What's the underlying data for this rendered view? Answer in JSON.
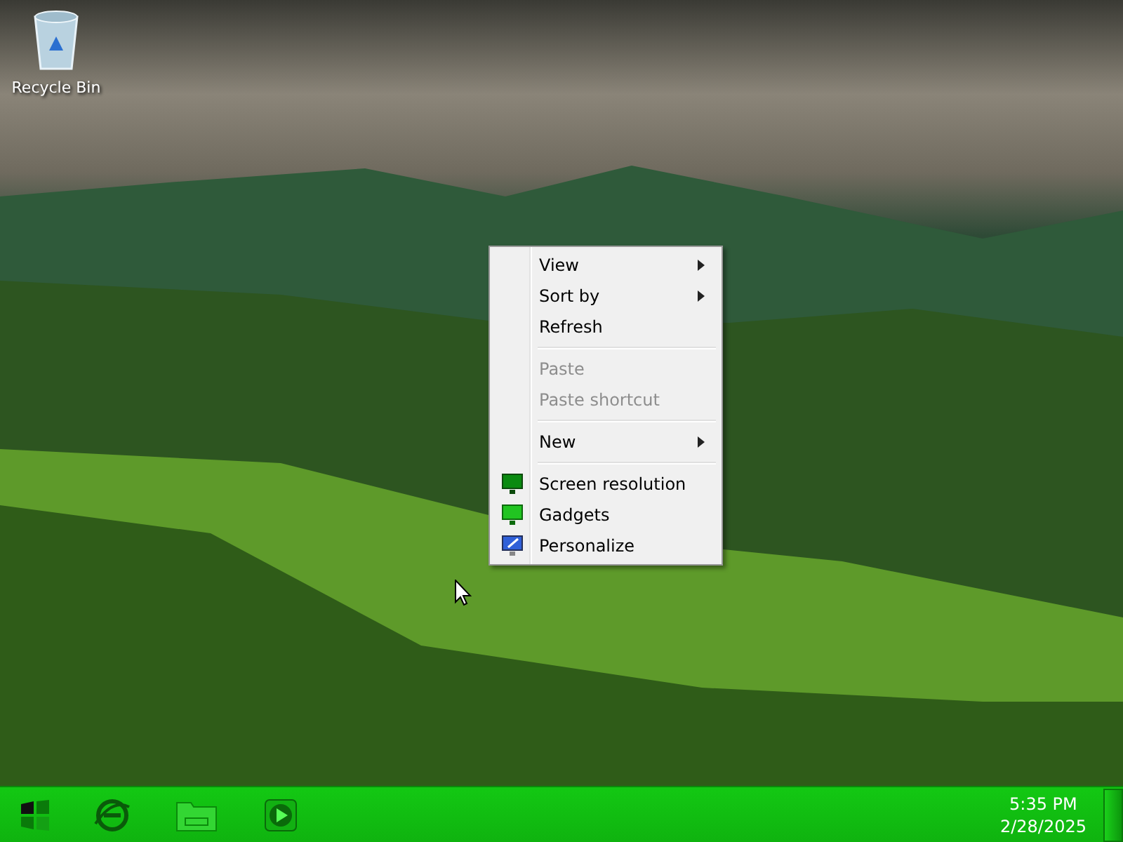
{
  "desktop": {
    "icons": [
      {
        "kind": "recycle-bin",
        "label": "Recycle Bin"
      }
    ]
  },
  "context_menu": {
    "items": [
      {
        "kind": "item",
        "label": "View",
        "disabled": false,
        "submenu": true
      },
      {
        "kind": "item",
        "label": "Sort by",
        "disabled": false,
        "submenu": true
      },
      {
        "kind": "item",
        "label": "Refresh",
        "disabled": false,
        "submenu": false
      },
      {
        "kind": "separator"
      },
      {
        "kind": "item",
        "label": "Paste",
        "disabled": true,
        "submenu": false
      },
      {
        "kind": "item",
        "label": "Paste shortcut",
        "disabled": true,
        "submenu": false
      },
      {
        "kind": "separator"
      },
      {
        "kind": "item",
        "label": "New",
        "disabled": false,
        "submenu": true
      },
      {
        "kind": "separator"
      },
      {
        "kind": "display",
        "label": "Screen resolution",
        "disabled": false,
        "submenu": false
      },
      {
        "kind": "gadgets",
        "label": "Gadgets",
        "disabled": false,
        "submenu": false
      },
      {
        "kind": "personalize",
        "label": "Personalize",
        "disabled": false,
        "submenu": false
      }
    ]
  },
  "taskbar": {
    "buttons": [
      {
        "kind": "start"
      },
      {
        "kind": "browser"
      },
      {
        "kind": "folder"
      },
      {
        "kind": "media"
      }
    ],
    "clock": {
      "time": "5:35 PM",
      "date": "2/28/2025"
    }
  }
}
